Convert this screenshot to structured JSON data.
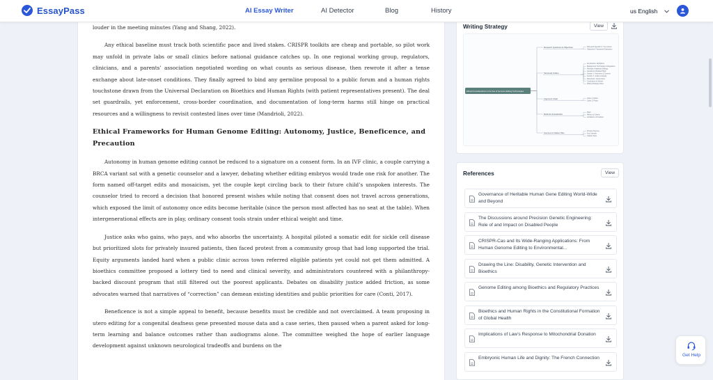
{
  "header": {
    "brand": "EssayPass",
    "nav": [
      "AI Essay Writer",
      "AI Detector",
      "Blog",
      "History"
    ],
    "active_nav": "AI Essay Writer",
    "language": "us English"
  },
  "document": {
    "blocks": [
      {
        "type": "p_cont",
        "text": "louder in the meeting minutes (Yang and Shang, 2022)."
      },
      {
        "type": "p",
        "text": "Any ethical baseline must track both scientific pace and lived stakes. CRISPR toolkits are cheap and portable, so pilot work may unfold in private labs or small clinics before national guidance catches up. In one regional working group, regulators, clinicians, and a parents’ association negotiated wording on what counts as serious disease, then rewrote it after a tense exchange about late-onset conditions. They finally agreed to bind any germline proposal to a public forum and a human rights touchstone drawn from the Universal Declaration on Bioethics and Human Rights (with patient representatives present). The deal set guardrails, yet enforcement, cross-border coordination, and documentation of long-term harms still hinge on practical resources and a willingness to revisit contested lines over time (Mandrioli, 2022)."
      },
      {
        "type": "h",
        "text": "Ethical Frameworks for Human Genome Editing: Autonomy, Justice, Beneficence, and Precaution"
      },
      {
        "type": "p",
        "text": "Autonomy in human genome editing cannot be reduced to a signature on a consent form. In an IVF clinic, a couple carrying a BRCA variant sat with a genetic counselor and a lawyer, debating whether editing embryos would trade one risk for another. The form named off-target edits and mosaicism, yet the couple kept circling back to their future child’s unspoken interests. The counselor tried to record a decision that honored present wishes while noting that consent does not travel across generations, which exposed the limit of autonomy once edits become heritable (since the person most affected has no seat at the table). When intergenerational effects are in play, ordinary consent tools strain under ethical weight and time."
      },
      {
        "type": "p",
        "text": "Justice asks who gains, who pays, and who absorbs the uncertainty. A hospital piloted a somatic edit for sickle cell disease but prioritized slots for privately insured patients, then faced protest from a community group that had long supported the trial. Equity arguments landed hard when a public clinic across town referred eligible patients yet could not get them admitted. A bioethics committee proposed a lottery tied to need and clinical severity, and administrators countered with a philanthropy-backed discount program that still filtered out the poorest applicants. Debates on disability justice added friction, as some advocates warned that narratives of “correction” can demean existing identities and public priorities for care (Conti, 2017)."
      },
      {
        "type": "p",
        "text": "Beneficence is not a simple appeal to benefit, because benefits must be credible and not overclaimed. A team proposing in utero editing for a congenital deafness gene presented mouse data and a case series, then paused when a parent asked for long-term learning and balance outcomes rather than audiograms alone. The committee weighed the hope of earlier language development against unknown neurological tradeoffs and burdens on the"
      }
    ]
  },
  "strategy": {
    "title": "Writing Strategy",
    "view_label": "View",
    "root": "Ethical Considerations in the Use of Genome Editing Technologies",
    "groups": [
      {
        "label": "Research Questions & Objectives",
        "leaves": [
          "Research Question 1: Key Issues",
          "Objectives: Framework Evaluation"
        ]
      },
      {
        "label": "Structural Outline",
        "leaves": [
          "Introduction: Definitions",
          "Background: Technology & Regulation",
          "Methods: Analytical Strategy",
          "Literature & Related Work",
          "Section 1: Autonomy & Consent",
          "Section 2: Justice & Equity",
          "Discussion: Governance",
          "Conclusion & Outlook",
          "Writing Strategy Notes"
        ]
      },
      {
        "label": "Argument Chain",
        "leaves": [
          "Claim 1: Ethics",
          "Claim 2: Policy"
        ]
      },
      {
        "label": "Methods & Evaluation",
        "leaves": [
          "Rigor",
          "Metrics & Criteria",
          "Limitations of Analysis"
        ]
      },
      {
        "label": "Sources & Citation Plan",
        "leaves": [
          "Primary Sources",
          "Key Journals",
          "Citation Style"
        ]
      }
    ]
  },
  "references": {
    "title": "References",
    "view_label": "View",
    "items": [
      "Governance of Heritable Human Gene Editing World-Wide and Beyond",
      "The Discussions around Precision Genetic Engineering: Role of and Impact on Disabled People",
      "CRISPR-Cas and Its Wide-Ranging Applications: From Human Genome Editing to Environmental...",
      "Drawing the Line: Disability, Genetic Intervention and Bioethics",
      "Genome Editing among Bioethics and Regulatory Practices",
      "Bioethics and Human Rights in the Constitutional Formation of Global Health",
      "Implications of Law’s Response to Mitochondrial Donation",
      "Embryonic Human Life and Dignity: The French Connection"
    ]
  },
  "help": {
    "label": "Get Help"
  },
  "colors": {
    "brand": "#2a56d8",
    "page_bg": "#eef1f7",
    "root_node": "#5b7f7a"
  }
}
